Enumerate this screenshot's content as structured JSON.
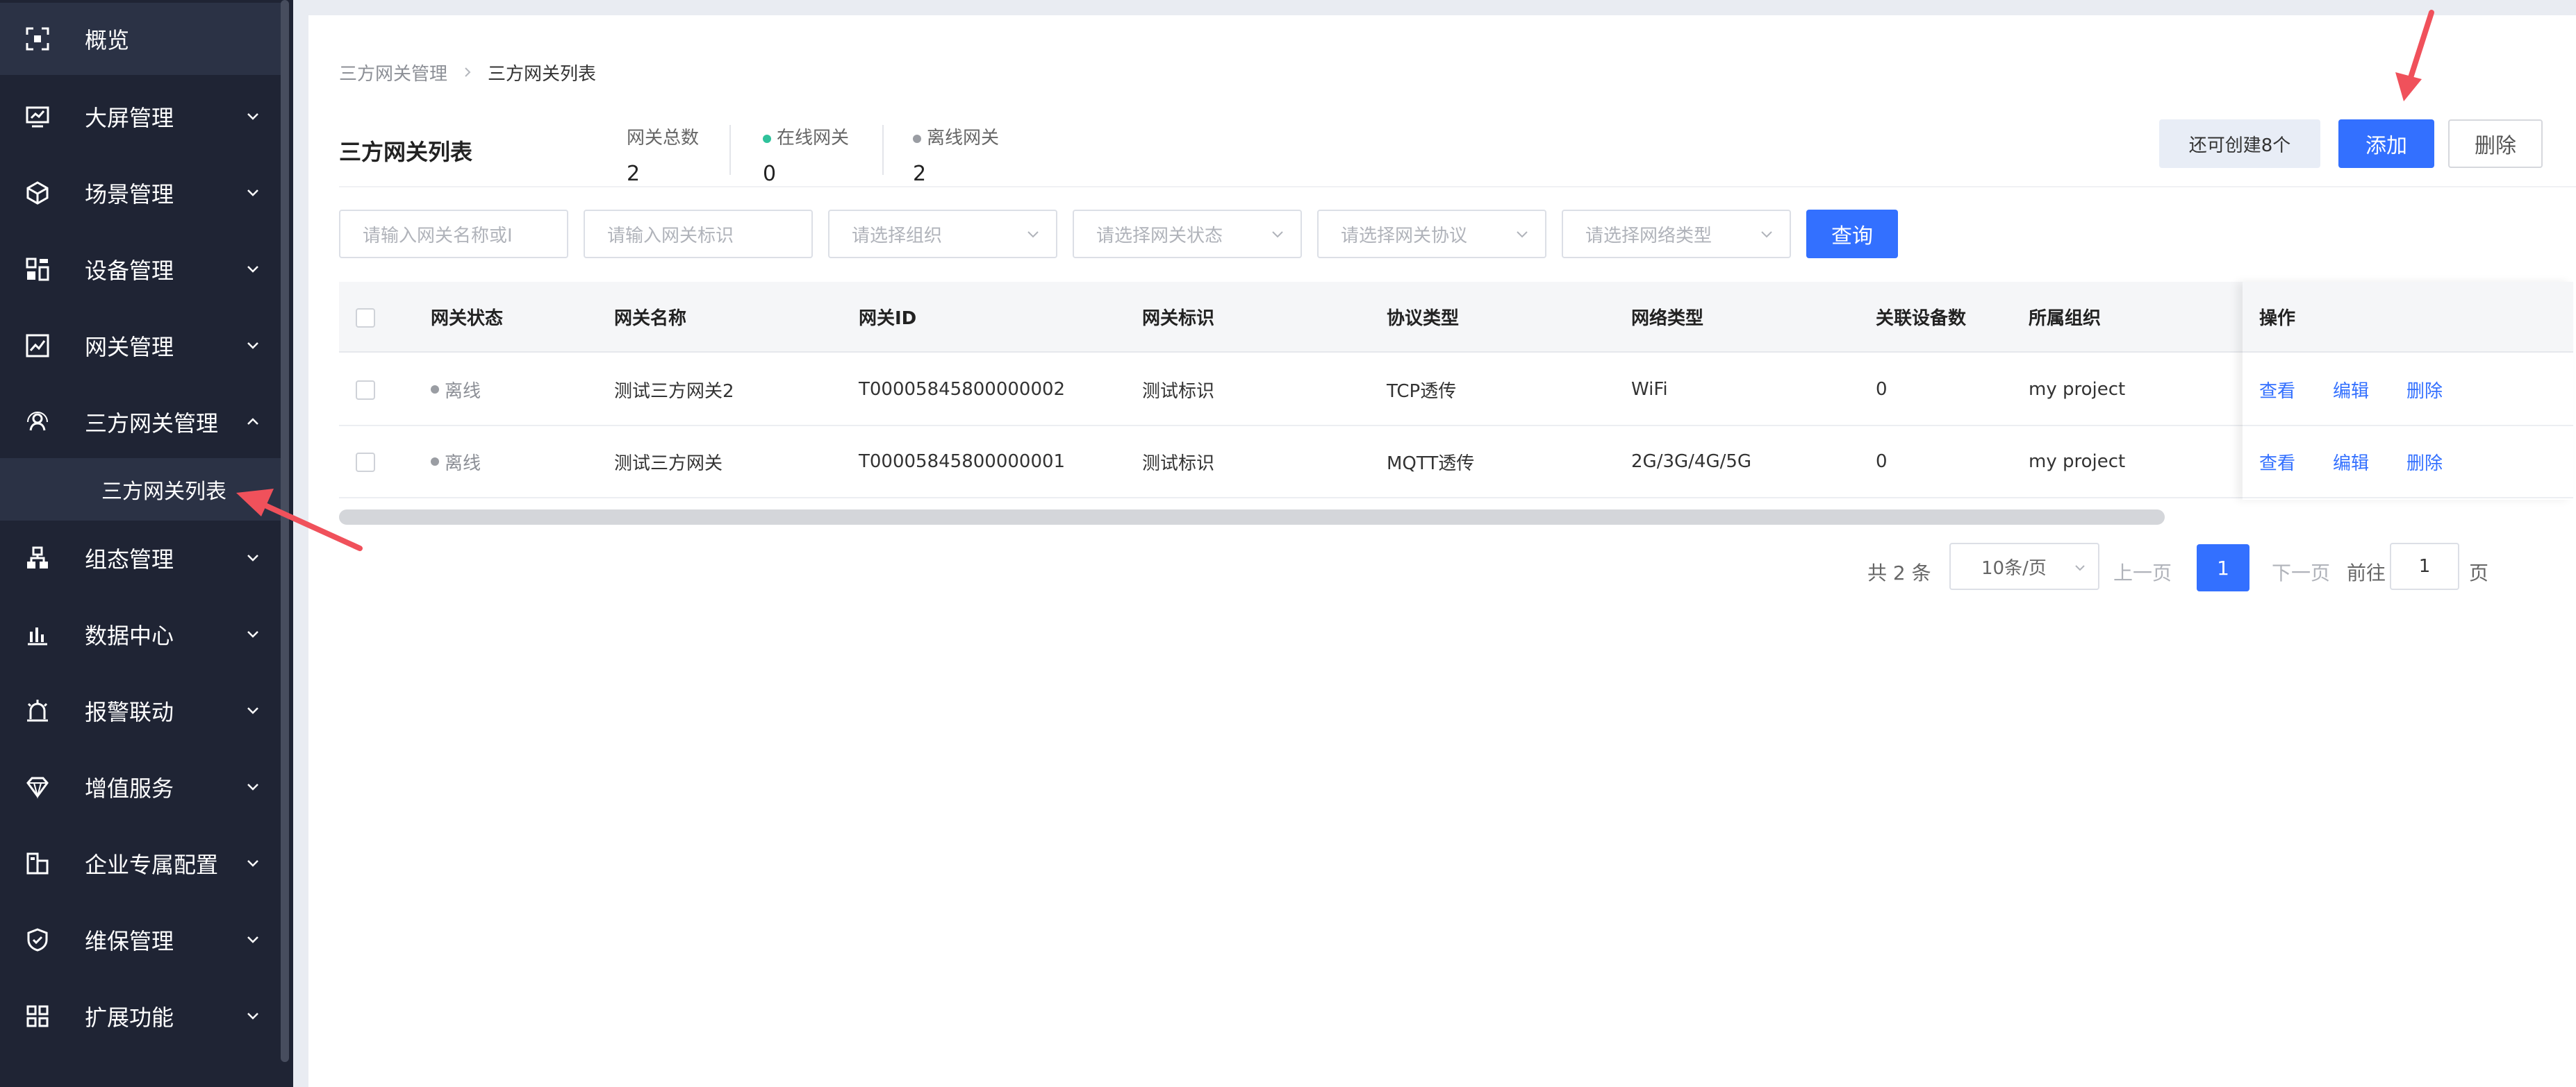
{
  "colors": {
    "sidebar_bg": "#1f2434",
    "accent": "#3370ff",
    "annotation": "#f0515b"
  },
  "sidebar": {
    "items": [
      {
        "label": "概览",
        "icon": "overview-icon",
        "expandable": false
      },
      {
        "label": "大屏管理",
        "icon": "monitor-icon",
        "expandable": true
      },
      {
        "label": "场景管理",
        "icon": "cube-icon",
        "expandable": true
      },
      {
        "label": "设备管理",
        "icon": "device-icon",
        "expandable": true
      },
      {
        "label": "网关管理",
        "icon": "chart-line-icon",
        "expandable": true
      },
      {
        "label": "三方网关管理",
        "icon": "user-network-icon",
        "expandable": true,
        "expanded": true
      },
      {
        "label": "组态管理",
        "icon": "org-tree-icon",
        "expandable": true
      },
      {
        "label": "数据中心",
        "icon": "bar-chart-icon",
        "expandable": true
      },
      {
        "label": "报警联动",
        "icon": "alarm-icon",
        "expandable": true
      },
      {
        "label": "增值服务",
        "icon": "diamond-icon",
        "expandable": true
      },
      {
        "label": "企业专属配置",
        "icon": "enterprise-icon",
        "expandable": true
      },
      {
        "label": "维保管理",
        "icon": "shield-check-icon",
        "expandable": true
      },
      {
        "label": "扩展功能",
        "icon": "grid-icon",
        "expandable": true
      }
    ],
    "sub_item": {
      "label": "三方网关列表"
    }
  },
  "breadcrumb": {
    "parent": "三方网关管理",
    "current": "三方网关列表"
  },
  "header": {
    "title": "三方网关列表",
    "stats": [
      {
        "label": "网关总数",
        "value": "2"
      },
      {
        "label": "在线网关",
        "value": "0",
        "dot": "#2fc29b"
      },
      {
        "label": "离线网关",
        "value": "2",
        "dot": "#9a9da3"
      }
    ],
    "quota_label": "还可创建8个",
    "add_label": "添加",
    "delete_label": "删除"
  },
  "filters": {
    "name_placeholder": "请输入网关名称或ID",
    "name_visible": "请输入网关名称或I",
    "mark_placeholder": "请输入网关标识",
    "org_placeholder": "请选择组织",
    "status_placeholder": "请选择网关状态",
    "protocol_placeholder": "请选择网关协议",
    "network_placeholder": "请选择网络类型",
    "query_label": "查询"
  },
  "table": {
    "columns": [
      "网关状态",
      "网关名称",
      "网关ID",
      "网关标识",
      "协议类型",
      "网络类型",
      "关联设备数",
      "所属组织",
      "操作"
    ],
    "rows": [
      {
        "status": "离线",
        "name": "测试三方网关2",
        "id": "T00005845800000002",
        "mark": "测试标识",
        "protocol": "TCP透传",
        "network": "WiFi",
        "devices": "0",
        "org": "my project"
      },
      {
        "status": "离线",
        "name": "测试三方网关",
        "id": "T00005845800000001",
        "mark": "测试标识",
        "protocol": "MQTT透传",
        "network": "2G/3G/4G/5G",
        "devices": "0",
        "org": "my project"
      }
    ],
    "actions": {
      "view": "查看",
      "edit": "编辑",
      "delete": "删除"
    }
  },
  "pagination": {
    "total_text": "共 2 条",
    "page_size": "10条/页",
    "prev": "上一页",
    "current_page": "1",
    "next": "下一页",
    "goto_label": "前往",
    "goto_value": "1",
    "page_suffix": "页"
  }
}
